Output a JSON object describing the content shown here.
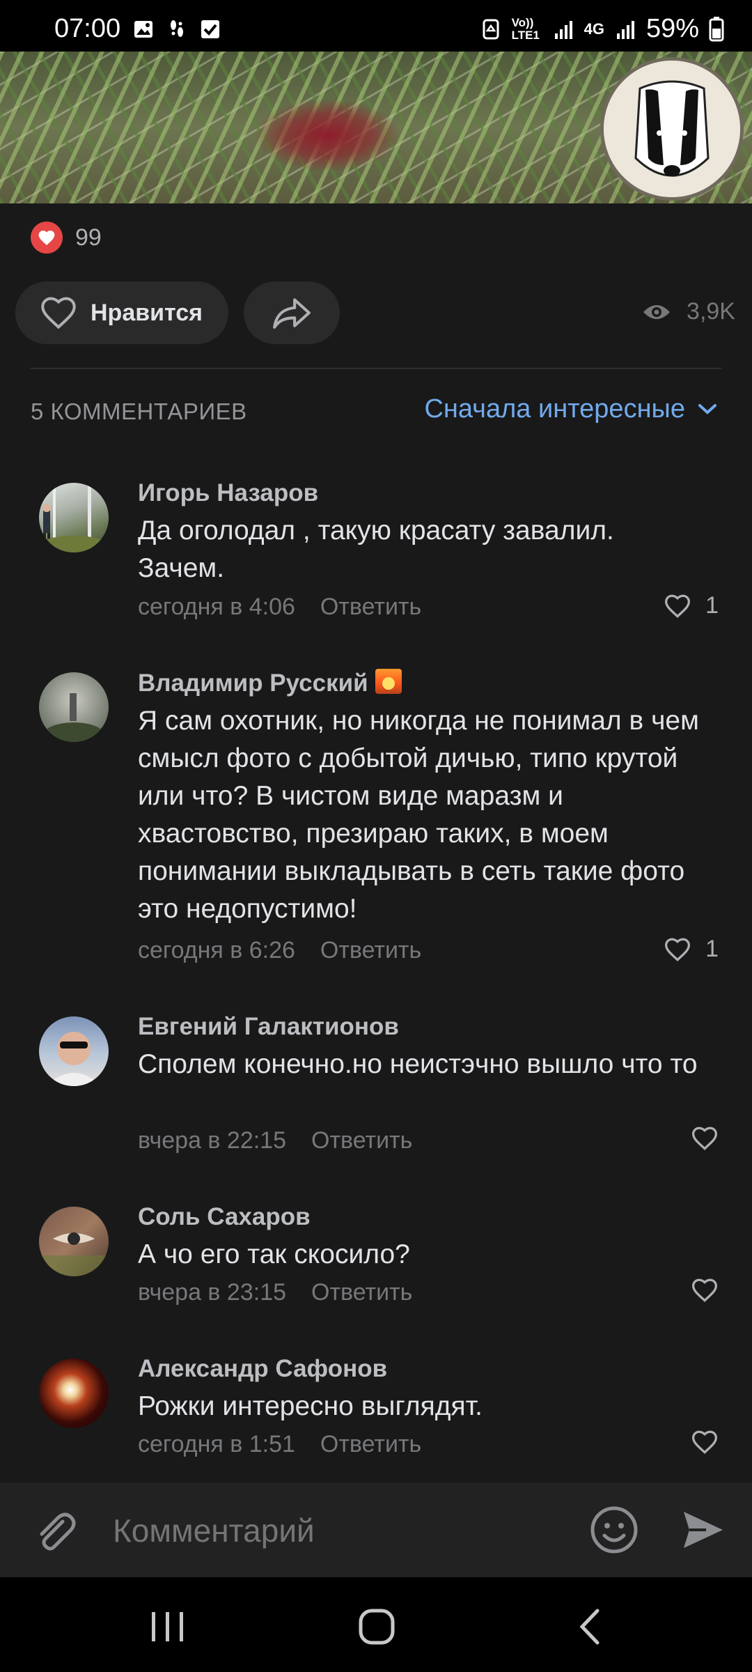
{
  "status_bar": {
    "time": "07:00",
    "network": "Vo)) LTE1",
    "network_type": "4G",
    "battery": "59%"
  },
  "post": {
    "likes_count": "99",
    "like_label": "Нравится",
    "views": "3,9K"
  },
  "comments_section": {
    "count_label": "5 КОММЕНТАРИЕВ",
    "sort_label": "Сначала интересные"
  },
  "comments": [
    {
      "author": "Игорь Назаров",
      "text": "Да  оголодал , такую красату  завалил. Зачем.",
      "time": "сегодня в 4:06",
      "reply": "Ответить",
      "likes": "1"
    },
    {
      "author": "Владимир Русский",
      "text": "Я сам охотник, но никогда не понимал в чем смысл фото с добытой дичью, типо крутой или что? В чистом виде маразм и хвастовство, презираю таких, в моем понимании выкладывать в сеть такие фото это недопустимо!",
      "time": "сегодня в 6:26",
      "reply": "Ответить",
      "likes": "1"
    },
    {
      "author": "Евгений Галактионов",
      "text": "Сполем конечно.но неистэчно вышло что то",
      "time": "вчера в 22:15",
      "reply": "Ответить",
      "likes": ""
    },
    {
      "author": "Соль Сахаров",
      "text": "А чо его так скосило?",
      "time": "вчера в 23:15",
      "reply": "Ответить",
      "likes": ""
    },
    {
      "author": "Александр Сафонов",
      "text": "Рожки интересно выглядят.",
      "time": "сегодня в 1:51",
      "reply": "Ответить",
      "likes": ""
    }
  ],
  "comment_input": {
    "placeholder": "Комментарий"
  },
  "colors": {
    "background": "#19191a",
    "accent": "#71aaeb",
    "like_red": "#e64646"
  },
  "icons": [
    "attach-icon",
    "emoji-icon",
    "send-icon",
    "heart-icon",
    "share-icon",
    "eye-icon",
    "chevron-down-icon"
  ]
}
